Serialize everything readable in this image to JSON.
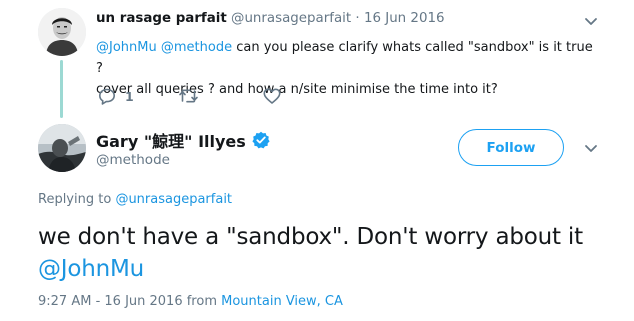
{
  "parent_tweet": {
    "author_name": "un rasage parfait",
    "author_handle": "@unrasageparfait",
    "separator": "·",
    "date": "16 Jun 2016",
    "mention_1": "@JohnMu",
    "mention_2": "@methode",
    "text_line_1": " can you please clarify whats called \"sandbox\" is it true ?",
    "text_line_2": "cover all queries ? and how a n/site minimise the time into it?",
    "reply_count": "1",
    "icons": [
      "reply-icon",
      "retweet-icon",
      "like-icon",
      "chevron-down-icon"
    ]
  },
  "main_tweet": {
    "author_name": "Gary \"鯨理\" Illyes",
    "author_handle": "@methode",
    "follow_label": "Follow",
    "replying_prefix": "Replying to",
    "replying_handle": "@unrasageparfait",
    "text": "we don't have a \"sandbox\". Don't worry about it ",
    "text_mention": "@JohnMu",
    "timestamp": "9:27 AM - 16 Jun 2016 from",
    "location": "Mountain View, CA",
    "icons": [
      "verified-icon",
      "chevron-down-icon"
    ]
  },
  "colors": {
    "accent": "#1da1f2",
    "link": "#1b95e0",
    "muted": "#657786",
    "text": "#14171a",
    "thread_line": "#9cd9d3"
  }
}
